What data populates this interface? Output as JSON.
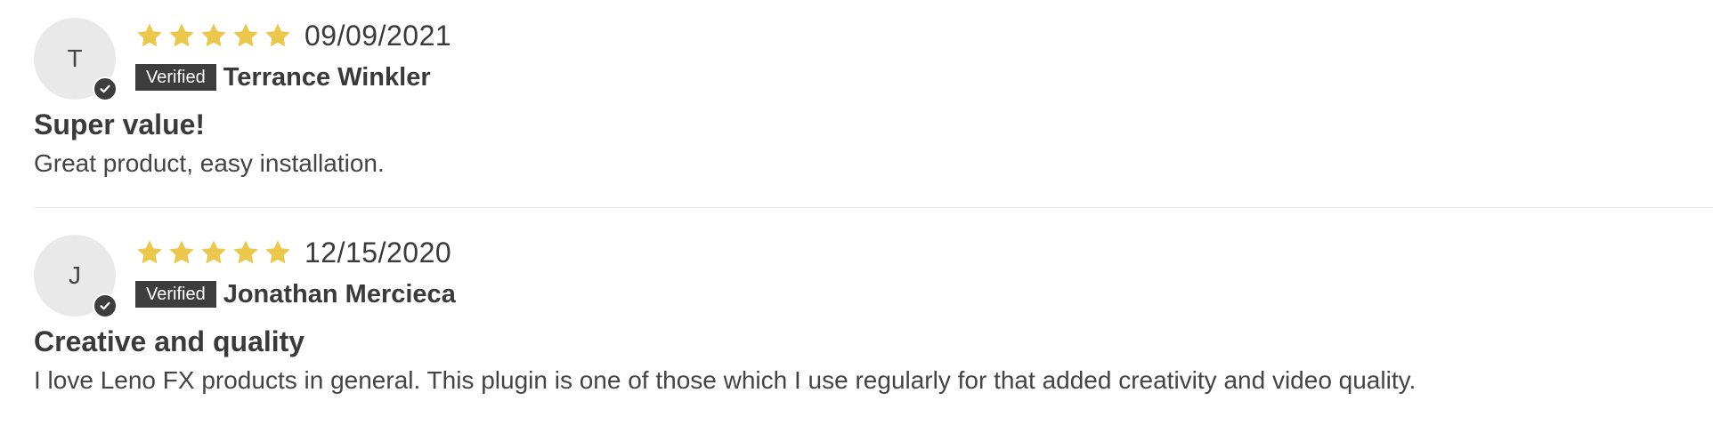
{
  "colors": {
    "star": "#EBC84C",
    "badge_bg": "#3D3D3D",
    "avatar_bg": "#E9E9E9",
    "text": "#3A3A3A"
  },
  "reviews": [
    {
      "avatar_initial": "T",
      "rating": 5,
      "rating_max": 5,
      "date": "09/09/2021",
      "verified_label": "Verified",
      "author": "Terrance Winkler",
      "title": "Super value!",
      "body": "Great product, easy installation."
    },
    {
      "avatar_initial": "J",
      "rating": 5,
      "rating_max": 5,
      "date": "12/15/2020",
      "verified_label": "Verified",
      "author": "Jonathan Mercieca",
      "title": "Creative and quality",
      "body": "I love Leno FX products in general. This plugin is one of those which I use regularly for that added creativity and video quality."
    }
  ]
}
